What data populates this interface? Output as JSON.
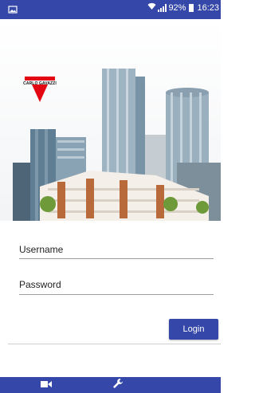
{
  "status_bar": {
    "battery_percent": "92%",
    "time": "16:23",
    "icons": [
      "image-icon",
      "wifi-icon",
      "signal-icon",
      "battery-icon"
    ]
  },
  "brand": {
    "logo_text": "CARLO GAVAZZI",
    "logo_color": "#e30613"
  },
  "form": {
    "username_label": "Username",
    "password_label": "Password",
    "login_label": "Login"
  },
  "bottom_nav": {
    "items": [
      {
        "icon": "video-camera-icon"
      },
      {
        "icon": "wrench-icon"
      }
    ]
  },
  "colors": {
    "primary": "#3547a8",
    "underline": "#9e9e9e"
  }
}
